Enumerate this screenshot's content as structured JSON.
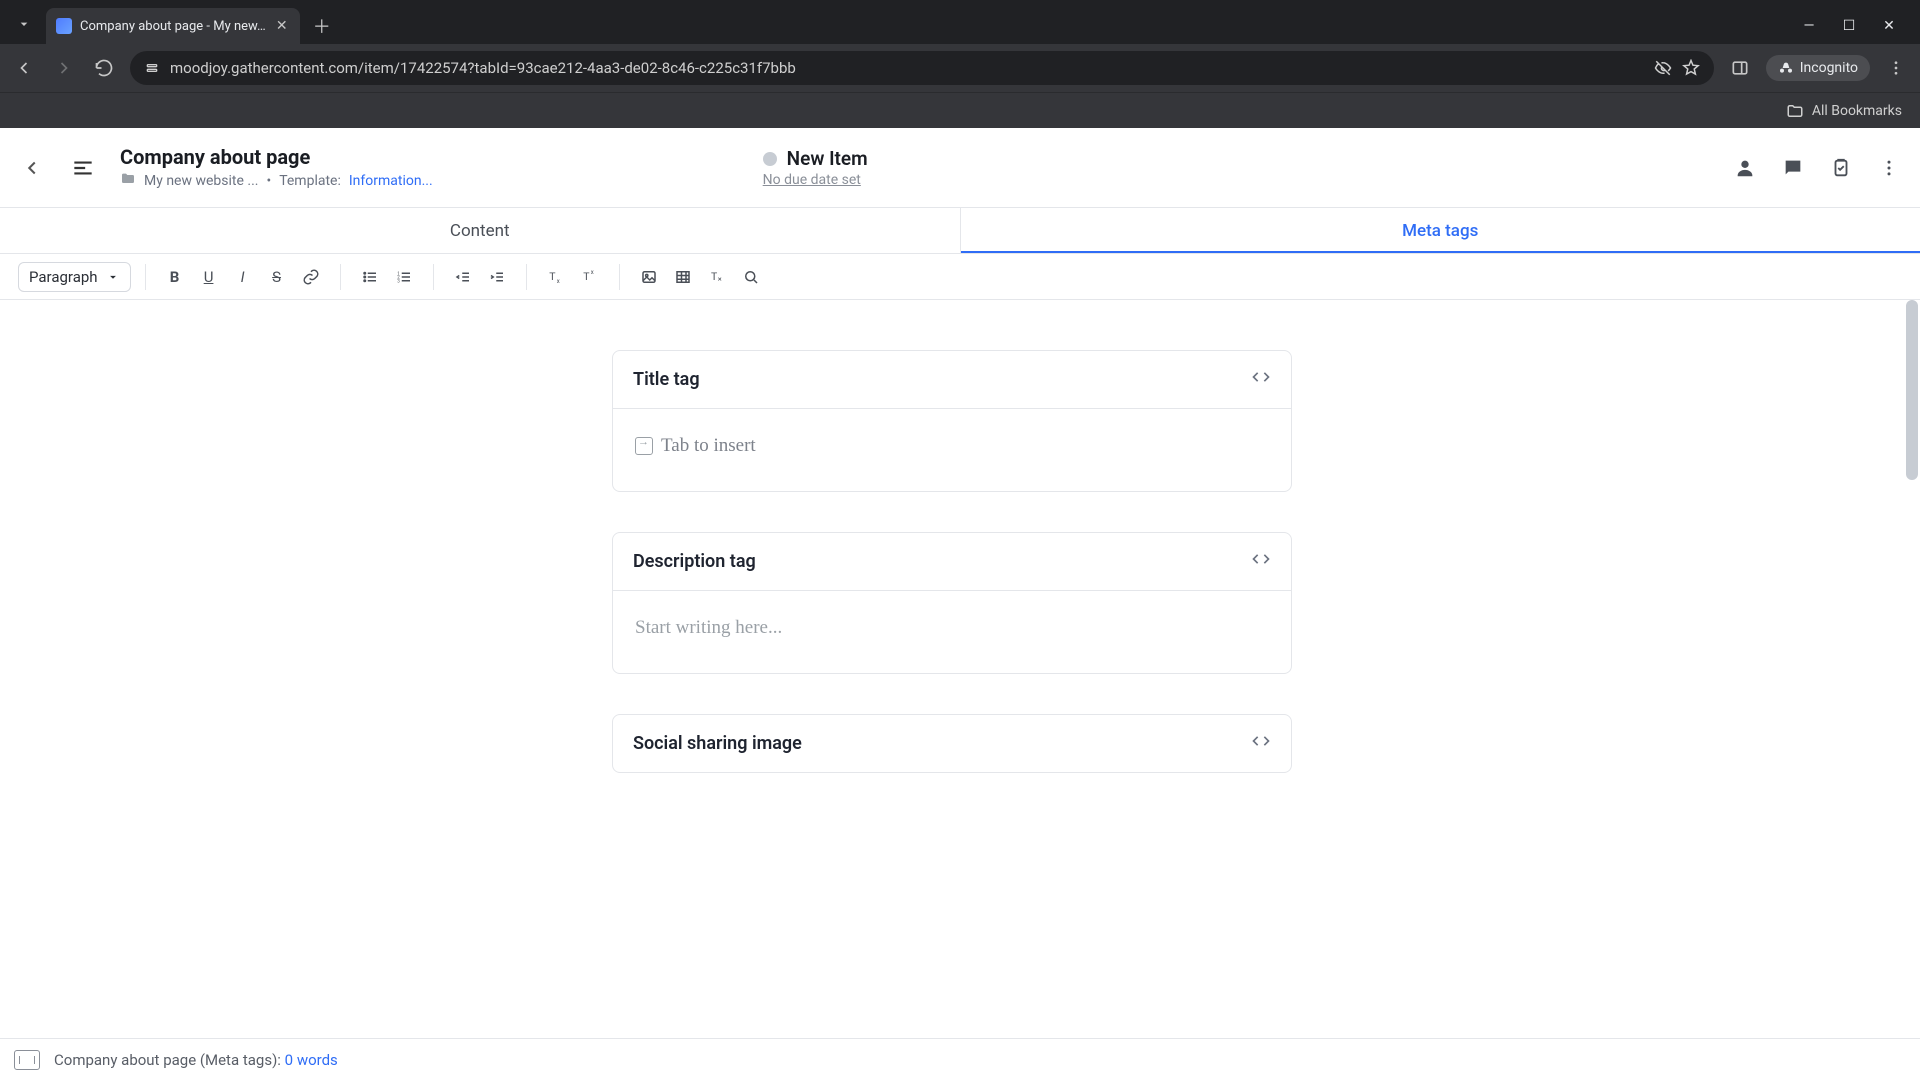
{
  "browser": {
    "tab_title": "Company about page - My new…",
    "url": "moodjoy.gathercontent.com/item/17422574?tabId=93cae212-4aa3-de02-8c46-c225c31f7bbb",
    "incognito_label": "Incognito",
    "all_bookmarks": "All Bookmarks"
  },
  "header": {
    "title": "Company about page",
    "breadcrumb_project": "My new website ...",
    "template_label": "Template:",
    "template_link": "Information...",
    "status_label": "New Item",
    "due_text": "No due date set"
  },
  "tabs": {
    "content": "Content",
    "meta": "Meta tags"
  },
  "toolbar": {
    "paragraph": "Paragraph"
  },
  "fields": {
    "title_tag": {
      "label": "Title tag",
      "hint": "Tab to insert"
    },
    "description_tag": {
      "label": "Description tag",
      "placeholder": "Start writing here..."
    },
    "social_image": {
      "label": "Social sharing image"
    }
  },
  "footer": {
    "context": "Company about page (Meta tags):",
    "words": "0 words"
  }
}
